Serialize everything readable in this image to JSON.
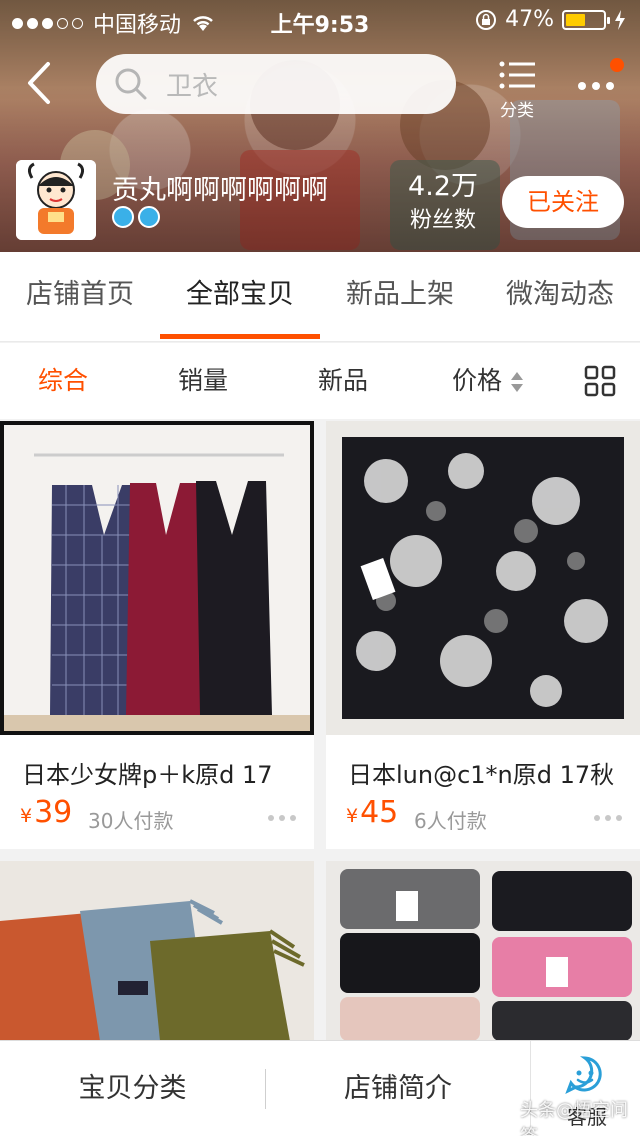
{
  "status_bar": {
    "carrier": "中国移动",
    "time": "上午9:53",
    "battery": "47%"
  },
  "search": {
    "placeholder": "卫衣"
  },
  "nav": {
    "category_label": "分类"
  },
  "shop": {
    "name": "贡丸啊啊啊啊啊啊",
    "fans_count": "4.2万",
    "fans_label": "粉丝数",
    "follow_label": "已关注"
  },
  "tabs": [
    {
      "label": "店铺首页"
    },
    {
      "label": "全部宝贝"
    },
    {
      "label": "新品上架"
    },
    {
      "label": "微淘动态"
    }
  ],
  "sort": {
    "items": [
      {
        "label": "综合"
      },
      {
        "label": "销量"
      },
      {
        "label": "新品"
      },
      {
        "label": "价格"
      }
    ]
  },
  "products": [
    {
      "title": "日本少女牌p＋k原d 17",
      "currency": "¥",
      "price": "39",
      "sales": "30人付款"
    },
    {
      "title": "日本lun@c1*n原d 17秋",
      "currency": "¥",
      "price": "45",
      "sales": "6人付款"
    },
    {
      "title": "",
      "currency": "",
      "price": "",
      "sales": ""
    },
    {
      "title": "",
      "currency": "",
      "price": "",
      "sales": ""
    }
  ],
  "bottom_bar": {
    "category_label": "宝贝分类",
    "intro_label": "店铺简介",
    "service_label": "客服"
  },
  "watermark": "头条@悟空问答",
  "colors": {
    "accent": "#ff5000",
    "battery": "#ffcc00"
  }
}
